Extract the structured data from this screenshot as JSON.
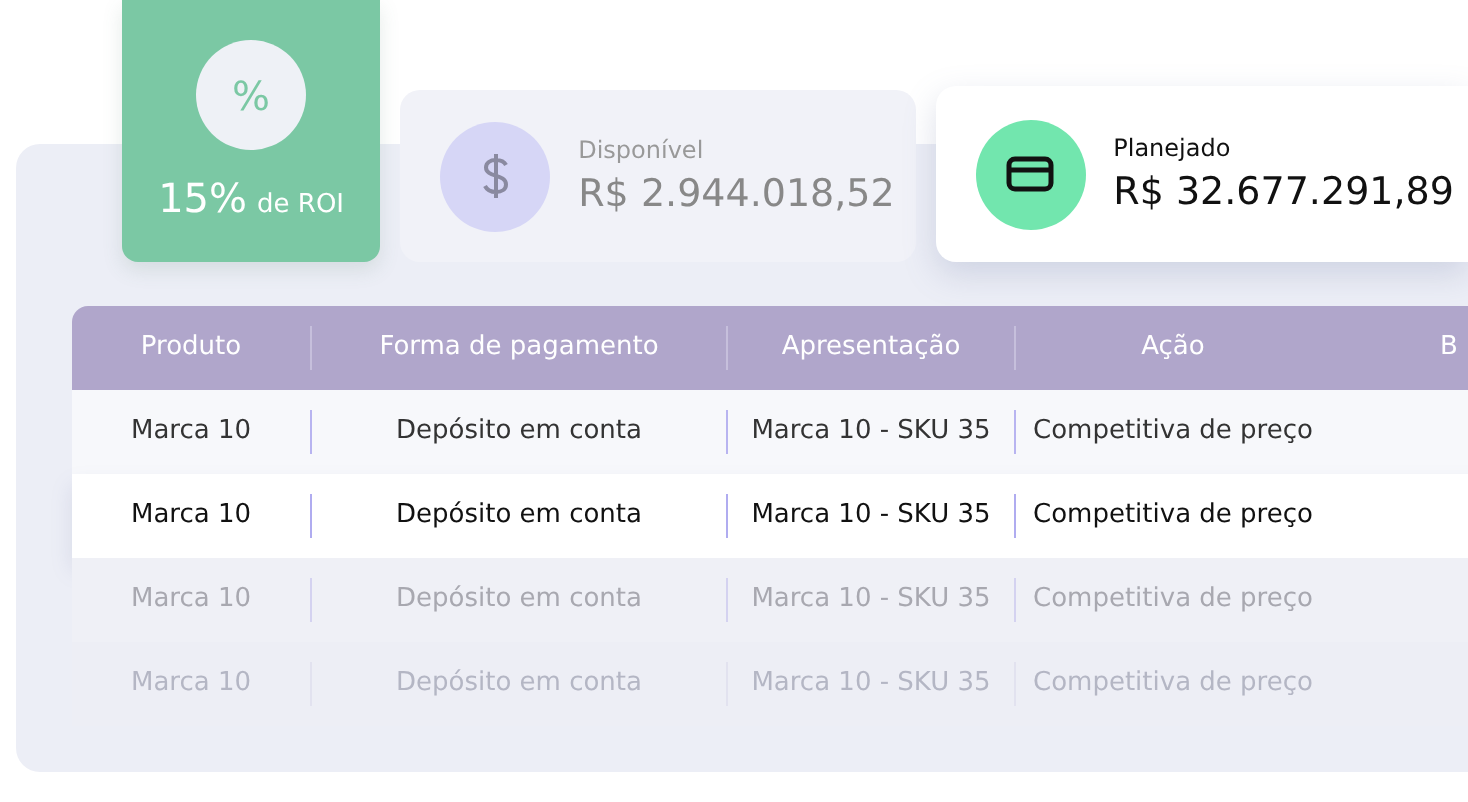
{
  "roi_card": {
    "icon_symbol": "%",
    "value": "15%",
    "label": "de ROI"
  },
  "stats": [
    {
      "kind": "muted",
      "label": "Disponível",
      "value": "R$ 2.944.018,52"
    },
    {
      "kind": "featured",
      "label": "Planejado",
      "value": "R$ 32.677.291,89"
    }
  ],
  "table": {
    "columns": [
      "Produto",
      "Forma de pagamento",
      "Apresentação",
      "Ação",
      "B"
    ],
    "rows": [
      {
        "kind": "normal",
        "cells": [
          "Marca 10",
          "Depósito em conta",
          "Marca 10 - SKU 35",
          "Competitiva de preço"
        ]
      },
      {
        "kind": "highlighted",
        "cells": [
          "Marca 10",
          "Depósito em conta",
          "Marca 10 - SKU 35",
          "Competitiva de preço"
        ]
      },
      {
        "kind": "faded",
        "cells": [
          "Marca 10",
          "Depósito em conta",
          "Marca 10 - SKU 35",
          "Competitiva de preço"
        ]
      },
      {
        "kind": "ghost",
        "cells": [
          "Marca 10",
          "Depósito em conta",
          "Marca 10 - SKU 35",
          "Competitiva de preço"
        ]
      }
    ]
  }
}
